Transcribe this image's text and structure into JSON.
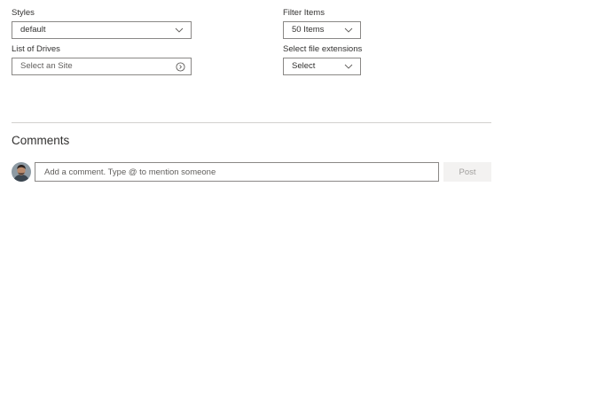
{
  "left_column": {
    "styles": {
      "label": "Styles",
      "value": "default",
      "icon": "chevron-down-icon"
    },
    "drives": {
      "label": "List of Drives",
      "placeholder": "Select an Site",
      "icon": "info-circle-icon"
    }
  },
  "right_column": {
    "filter": {
      "label": "Filter Items",
      "value": "50 Items",
      "icon": "chevron-down-icon"
    },
    "extensions": {
      "label": "Select file extensions",
      "value": "Select",
      "icon": "chevron-down-icon"
    }
  },
  "comments": {
    "heading": "Comments",
    "avatar": "user-avatar",
    "input_placeholder": "Add a comment. Type @ to mention someone",
    "post_label": "Post"
  },
  "colors": {
    "border": "#8a8886",
    "text": "#323130",
    "divider": "#d2d0ce",
    "post_bg": "#f3f2f1",
    "post_text": "#a19f9d"
  }
}
